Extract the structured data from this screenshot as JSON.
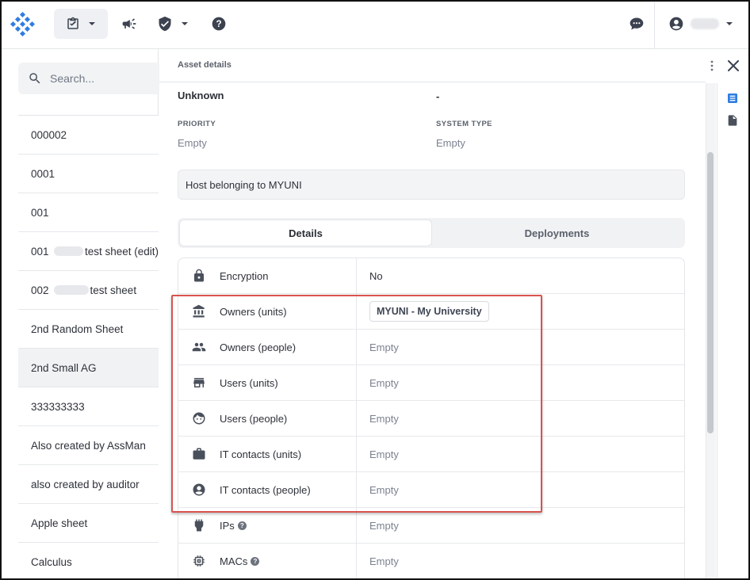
{
  "topbar": {
    "brand_color": "#2f7de1"
  },
  "search": {
    "placeholder": "Search..."
  },
  "list": {
    "items": [
      {
        "label": "000002"
      },
      {
        "label": "0001"
      },
      {
        "label": "001"
      },
      {
        "prefix": "001",
        "label": "test sheet (edit)"
      },
      {
        "prefix": "002",
        "label": "test sheet"
      },
      {
        "label": "2nd Random Sheet"
      },
      {
        "label": "2nd Small AG"
      },
      {
        "label": "333333333"
      },
      {
        "label": "Also created by AssMan"
      },
      {
        "label": "also created by auditor"
      },
      {
        "label": "Apple sheet"
      },
      {
        "label": "Calculus"
      }
    ]
  },
  "panel": {
    "title": "Asset details",
    "top_left_value": "Unknown",
    "top_right_value": "-",
    "priority_label": "PRIORITY",
    "priority_value": "Empty",
    "system_type_label": "SYSTEM TYPE",
    "system_type_value": "Empty",
    "description": "Host belonging to MYUNI",
    "tabs": [
      {
        "label": "Details",
        "active": true
      },
      {
        "label": "Deployments",
        "active": false
      }
    ],
    "rows": [
      {
        "icon": "lock-icon",
        "label": "Encryption",
        "value": "No"
      },
      {
        "icon": "bank-icon",
        "label": "Owners (units)",
        "value": "MYUNI - My University"
      },
      {
        "icon": "people-icon",
        "label": "Owners (people)",
        "value": "Empty"
      },
      {
        "icon": "store-icon",
        "label": "Users (units)",
        "value": "Empty"
      },
      {
        "icon": "face-icon",
        "label": "Users (people)",
        "value": "Empty"
      },
      {
        "icon": "briefcase-icon",
        "label": "IT contacts (units)",
        "value": "Empty"
      },
      {
        "icon": "account-circle-icon",
        "label": "IT contacts (people)",
        "value": "Empty"
      },
      {
        "icon": "network-port-icon",
        "label": "IPs",
        "value": "Empty"
      },
      {
        "icon": "chip-icon",
        "label": "MACs",
        "value": "Empty"
      }
    ]
  },
  "colors": {
    "highlight": "#d9534f",
    "rail_active": "#2f7de1"
  }
}
